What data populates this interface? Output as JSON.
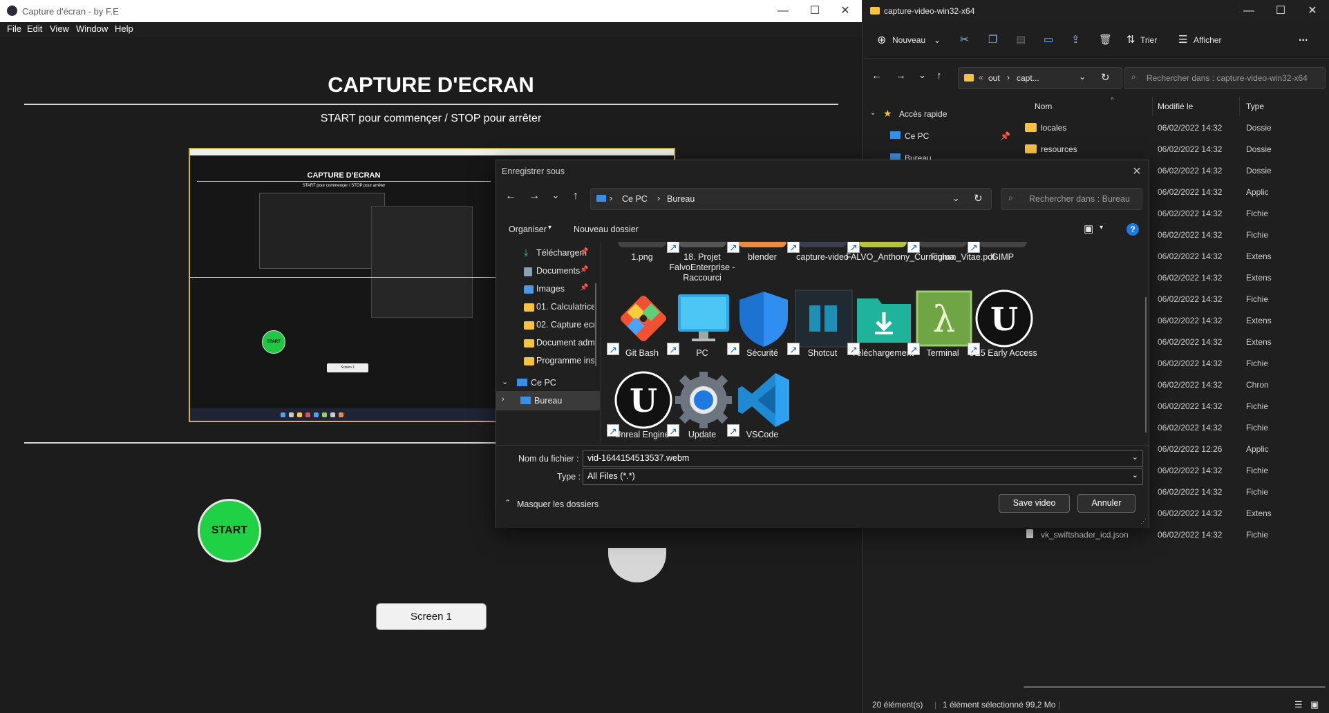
{
  "app": {
    "title": "Capture d'écran - by F.E",
    "menu": [
      "File",
      "Edit",
      "View",
      "Window",
      "Help"
    ],
    "heading": "CAPTURE D'ECRAN",
    "subtitle": "START pour commençer / STOP pour arrêter",
    "start_label": "START",
    "screen_button": "Screen 1",
    "preview_heading": "CAPTURE D'ECRAN",
    "preview_subtitle": "START pour commençer / STOP pour arrêter",
    "preview_start": "START",
    "preview_screen": "Screen 1",
    "window_controls": [
      "—",
      "☐",
      "✕"
    ]
  },
  "explorer": {
    "title": "capture-video-win32-x64",
    "toolbar": {
      "new": "Nouveau",
      "sort": "Trier",
      "view": "Afficher",
      "more": "..."
    },
    "address": [
      "«",
      "out",
      "›",
      "capt..."
    ],
    "search_placeholder": "Rechercher dans : capture-video-win32-x64",
    "tree": [
      {
        "label": "Accès rapide",
        "icon": "star-icon"
      },
      {
        "label": "Ce PC",
        "icon": "pc-icon"
      },
      {
        "label": "Bureau",
        "icon": "desktop-icon"
      }
    ],
    "columns": {
      "name": "Nom",
      "modified": "Modifié le",
      "type": "Type"
    },
    "rows": [
      {
        "name": "locales",
        "date": "06/02/2022 14:32",
        "type": "Dossie",
        "folder": true
      },
      {
        "name": "resources",
        "date": "06/02/2022 14:32",
        "type": "Dossie",
        "folder": true
      },
      {
        "name": "",
        "date": "06/02/2022 14:32",
        "type": "Dossie",
        "folder": false
      },
      {
        "name": "",
        "date": "06/02/2022 14:32",
        "type": "Applic",
        "folder": false
      },
      {
        "name": "",
        "date": "06/02/2022 14:32",
        "type": "Fichie",
        "folder": false
      },
      {
        "name": "",
        "date": "06/02/2022 14:32",
        "type": "Fichie",
        "folder": false
      },
      {
        "name": "",
        "date": "06/02/2022 14:32",
        "type": "Extens",
        "folder": false
      },
      {
        "name": "",
        "date": "06/02/2022 14:32",
        "type": "Extens",
        "folder": false
      },
      {
        "name": "",
        "date": "06/02/2022 14:32",
        "type": "Fichie",
        "folder": false
      },
      {
        "name": "",
        "date": "06/02/2022 14:32",
        "type": "Extens",
        "folder": false
      },
      {
        "name": "",
        "date": "06/02/2022 14:32",
        "type": "Extens",
        "folder": false
      },
      {
        "name": "",
        "date": "06/02/2022 14:32",
        "type": "Fichie",
        "folder": false
      },
      {
        "name": "",
        "date": "06/02/2022 14:32",
        "type": "Chron",
        "folder": false
      },
      {
        "name": "",
        "date": "06/02/2022 14:32",
        "type": "Fichie",
        "folder": false
      },
      {
        "name": "",
        "date": "06/02/2022 14:32",
        "type": "Fichie",
        "folder": false
      },
      {
        "name": "",
        "date": "06/02/2022 12:26",
        "type": "Applic",
        "folder": false
      },
      {
        "name": "",
        "date": "06/02/2022 14:32",
        "type": "Fichie",
        "folder": false
      },
      {
        "name": "",
        "date": "06/02/2022 14:32",
        "type": "Fichie",
        "folder": false
      },
      {
        "name": "",
        "date": "06/02/2022 14:32",
        "type": "Extens",
        "folder": false
      },
      {
        "name": "vk_swiftshader_icd.json",
        "date": "06/02/2022 14:32",
        "type": "Fichie",
        "folder": false
      }
    ],
    "status": {
      "count": "20 élément(s)",
      "selected": "1 élément sélectionné 99,2 Mo"
    }
  },
  "dialog": {
    "title": "Enregistrer sous",
    "address": [
      "Ce PC",
      "›",
      "Bureau"
    ],
    "search_placeholder": "Rechercher dans : Bureau",
    "organize": "Organiser",
    "new_folder": "Nouveau dossier",
    "nav": [
      {
        "label": "Téléchargem",
        "icon": "download-icon",
        "pinned": true
      },
      {
        "label": "Documents",
        "icon": "documents-icon",
        "pinned": true
      },
      {
        "label": "Images",
        "icon": "images-icon",
        "pinned": true
      },
      {
        "label": "01. Calculatrice",
        "icon": "folder-icon",
        "pinned": false
      },
      {
        "label": "02. Capture ecr",
        "icon": "folder-icon",
        "pinned": false
      },
      {
        "label": "Document adm",
        "icon": "folder-icon",
        "pinned": false
      },
      {
        "label": "Programme ins",
        "icon": "folder-icon",
        "pinned": false
      },
      {
        "label": "Ce PC",
        "icon": "pc-icon",
        "pinned": false
      },
      {
        "label": "Bureau",
        "icon": "desktop-icon",
        "pinned": false
      }
    ],
    "files_top": [
      "1.png",
      "18. Projet FalvoEnterprise - Raccourci",
      "blender",
      "capture-video",
      "FALVO_Anthony_Curriculum_Vitae.pdf",
      "Figma",
      "GIMP"
    ],
    "files_mid": [
      "Git Bash",
      "PC",
      "Sécurité",
      "Shotcut",
      "Téléchargement",
      "Terminal",
      "UE5 Early Access"
    ],
    "files_bot": [
      "Unreal Engine",
      "Update",
      "VSCode"
    ],
    "filename_label": "Nom du fichier :",
    "filename": "vid-1644154513537.webm",
    "type_label": "Type :",
    "type": "All Files (*.*)",
    "hide_folders": "Masquer les dossiers",
    "save": "Save video",
    "cancel": "Annuler"
  }
}
